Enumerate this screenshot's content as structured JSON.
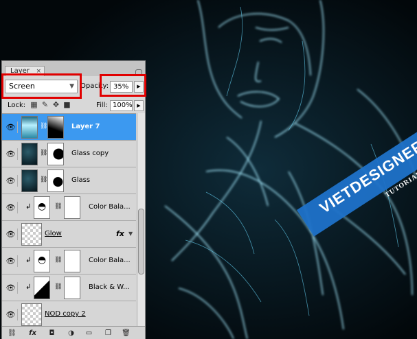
{
  "panel": {
    "tab_label": "Layer",
    "tab_close": "×",
    "blend_mode": "Screen",
    "opacity_label": "Opacity:",
    "opacity_value": "35%",
    "lock_label": "Lock:",
    "fill_label": "Fill:",
    "fill_value": "100%"
  },
  "layers": [
    {
      "name": "Layer 7",
      "selected": true
    },
    {
      "name": "Glass copy"
    },
    {
      "name": "Glass"
    },
    {
      "name": "Color Bala..."
    },
    {
      "name": "Glow",
      "effects": "fx"
    },
    {
      "name": "Color Bala..."
    },
    {
      "name": "Black & W..."
    },
    {
      "name": "NOD copy 2"
    }
  ],
  "footer_icons": [
    "link-icon",
    "fx-icon",
    "mask-icon",
    "adjustment-icon",
    "folder-icon",
    "new-layer-icon",
    "trash-icon"
  ],
  "watermark": {
    "main": "VIETDESIGNER.NET",
    "sub": "TUTORIAL"
  },
  "colors": {
    "selection": "#3c99f0",
    "highlight": "#e10000",
    "glow": "#7fd8ff"
  }
}
